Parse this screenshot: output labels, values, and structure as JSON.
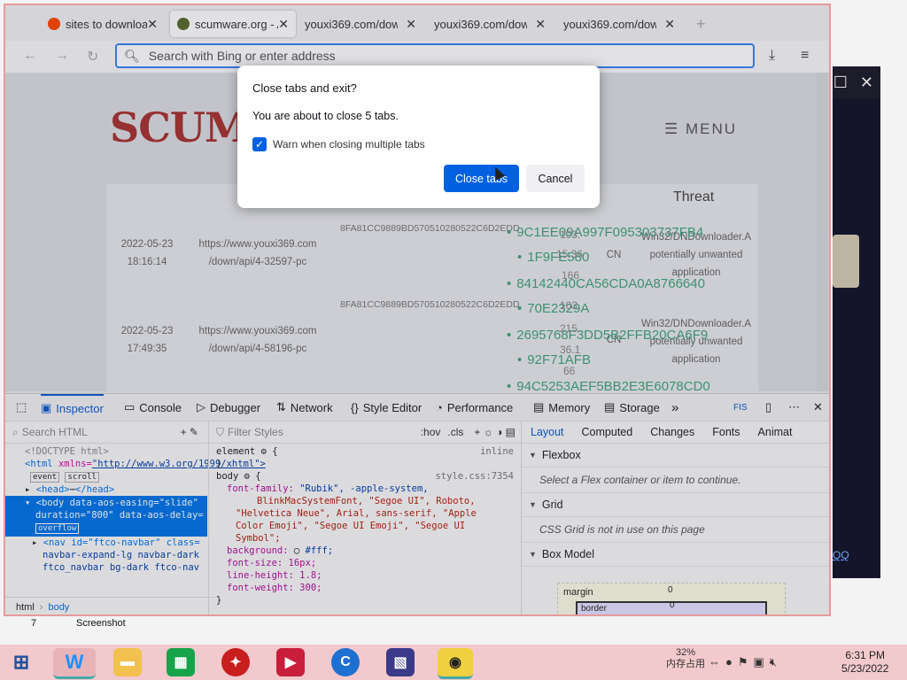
{
  "browser": {
    "tabs": [
      {
        "label": "sites to downloa",
        "color": "#ff4500"
      },
      {
        "label": "scumware.org - A",
        "color": "#5a6b2a"
      },
      {
        "label": "youxi369.com/dow",
        "color": ""
      },
      {
        "label": "youxi369.com/dow",
        "color": ""
      },
      {
        "label": "youxi369.com/dow",
        "color": ""
      }
    ],
    "new_tab": "+",
    "url_placeholder": "Search with Bing or enter address"
  },
  "page": {
    "logo": "SCUMWA",
    "menu": "☰ MENU",
    "threat_header": "Threat",
    "rows": [
      {
        "date": "2022-05-23",
        "time": "18:16:14",
        "url1": "https://www.youxi369.com",
        "url2": "/down/api/4-32597-pc",
        "md5": "8FA81CC9889BD570510280522C6D2EDD",
        "cc": "CN",
        "threat1": "Win32/DNDownloader.A",
        "threat2": "potentially unwanted",
        "threat3": "application"
      },
      {
        "date": "2022-05-23",
        "time": "17:49:35",
        "url1": "https://www.youxi369.com",
        "url2": "/down/api/4-58196-pc",
        "md5": "8FA81CC9889BD570510280522C6D2EDD",
        "cc": "CN",
        "threat1": "Win32/DNDownloader.A",
        "threat2": "potentially unwanted",
        "threat3": "application"
      }
    ],
    "green_hashes": [
      "9C1EE09A997F095303737FB4",
      "1F9FE580",
      "84142440CA56CDA0A8766640",
      "70E2329A",
      "2695768F3DD5B2FFB20CA6F9",
      "92F71AFB",
      "94C5253AEF5BB2E3E6078CD0"
    ],
    "ips": [
      "103.",
      "15.36",
      "166",
      "103.",
      "215.",
      "36.1",
      "66"
    ]
  },
  "devtools": {
    "tabs": [
      "Inspector",
      "Console",
      "Debugger",
      "Network",
      "Style Editor",
      "Performance",
      "Memory",
      "Storage"
    ],
    "more": "»",
    "search_html": "Search HTML",
    "filter_styles": "Filter Styles",
    "hov": ":hov",
    "cls": ".cls",
    "html_lines": {
      "doctype": "<!DOCTYPE html>",
      "html_tag": "<html",
      "xmlns_attr": "xmlns=",
      "xmlns_val": "\"http://www.w3.org/1999/xhtml\">",
      "event": "event",
      "scroll": "scroll",
      "head": "<head>",
      "head_close": "</head>",
      "body_line1": "<body data-aos-easing=\"slide\"",
      "body_line2": "duration=\"800\" data-aos-delay=",
      "overflow": "overflow",
      "nav_line1": "<nav id=\"ftco-navbar\" class=",
      "nav_line2": "navbar-expand-lg navbar-dark",
      "nav_line3": "ftco_navbar bg-dark ftco-nav"
    },
    "rules": {
      "element": "element",
      "inline": "inline",
      "body": "body",
      "source": "style.css:7354",
      "font_family_label": "font-family:",
      "font_family_value1": "\"Rubik\", -apple-system,",
      "font_family_value2": "BlinkMacSystemFont, \"Segoe UI\", Roboto,",
      "font_family_value3": "\"Helvetica Neue\", Arial, sans-serif, \"Apple",
      "font_family_value4": "Color Emoji\", \"Segoe UI Emoji\", \"Segoe UI",
      "font_family_value5": "Symbol\";",
      "background_label": "background:",
      "background_value": "#fff;",
      "font_size": "font-size: 16px;",
      "line_height": "line-height: 1.8;",
      "font_weight": "font-weight: 300;"
    },
    "layout_tabs": [
      "Layout",
      "Computed",
      "Changes",
      "Fonts",
      "Animat"
    ],
    "flexbox": "Flexbox",
    "flexbox_note": "Select a Flex container or item to continue.",
    "grid": "Grid",
    "grid_note": "CSS Grid is not in use on this page",
    "box_model": "Box Model",
    "margin_label": "margin",
    "border_label": "border",
    "zero": "0",
    "breadcrumb_html": "html",
    "breadcrumb_body": "body"
  },
  "dialog": {
    "title": "Close tabs and exit?",
    "message": "You are about to close 5 tabs.",
    "checkbox_label": "Warn when closing multiple tabs",
    "checkbox_checked": true,
    "close_button": "Close tabs",
    "cancel_button": "Cancel"
  },
  "desktop": {
    "screenshot_label": "Screenshot",
    "num_label": "7",
    "right_link": "QQ"
  },
  "taskbar": {
    "cpu_percent": "32%",
    "cpu_label": "内存占用",
    "time": "6:31 PM",
    "date": "5/23/2022"
  }
}
